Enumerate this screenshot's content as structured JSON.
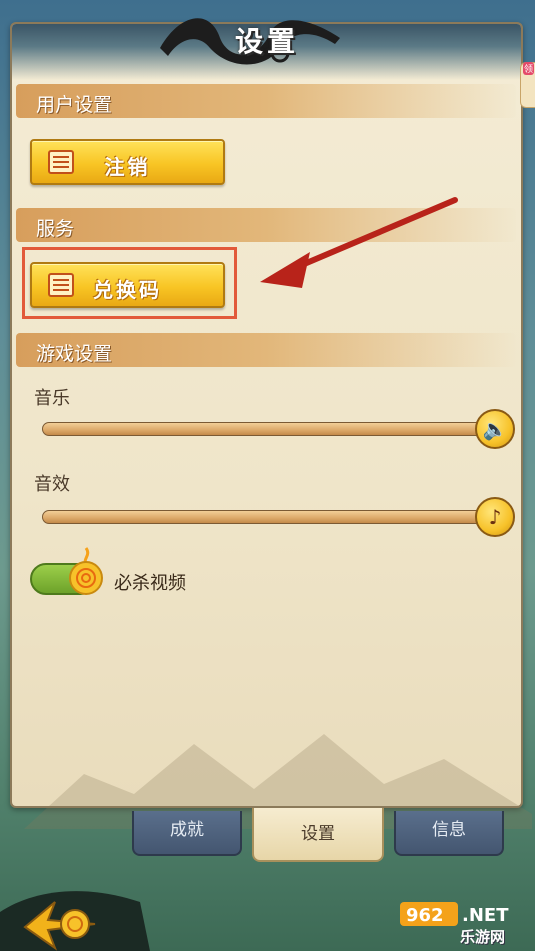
{
  "header": {
    "title": "设置"
  },
  "sections": {
    "user_settings": {
      "label": "用户设置",
      "logout_button": "注销"
    },
    "services": {
      "label": "服务",
      "redeem_button": "兑换码"
    },
    "game_settings": {
      "label": "游戏设置",
      "music_label": "音乐",
      "sound_label": "音效",
      "music_level": 1.0,
      "sound_level": 1.0,
      "finisher_video_label": "必杀视频",
      "finisher_video_on": true
    }
  },
  "tabs": [
    {
      "label": "成就"
    },
    {
      "label": "设置"
    },
    {
      "label": "信息"
    }
  ],
  "side_tab": {
    "badge": "领"
  },
  "watermark": {
    "logo": "962.NET",
    "text": "乐游网"
  },
  "colors": {
    "accent": "#f8c524",
    "highlight": "#e25a3a",
    "arrow": "#b8231a"
  }
}
